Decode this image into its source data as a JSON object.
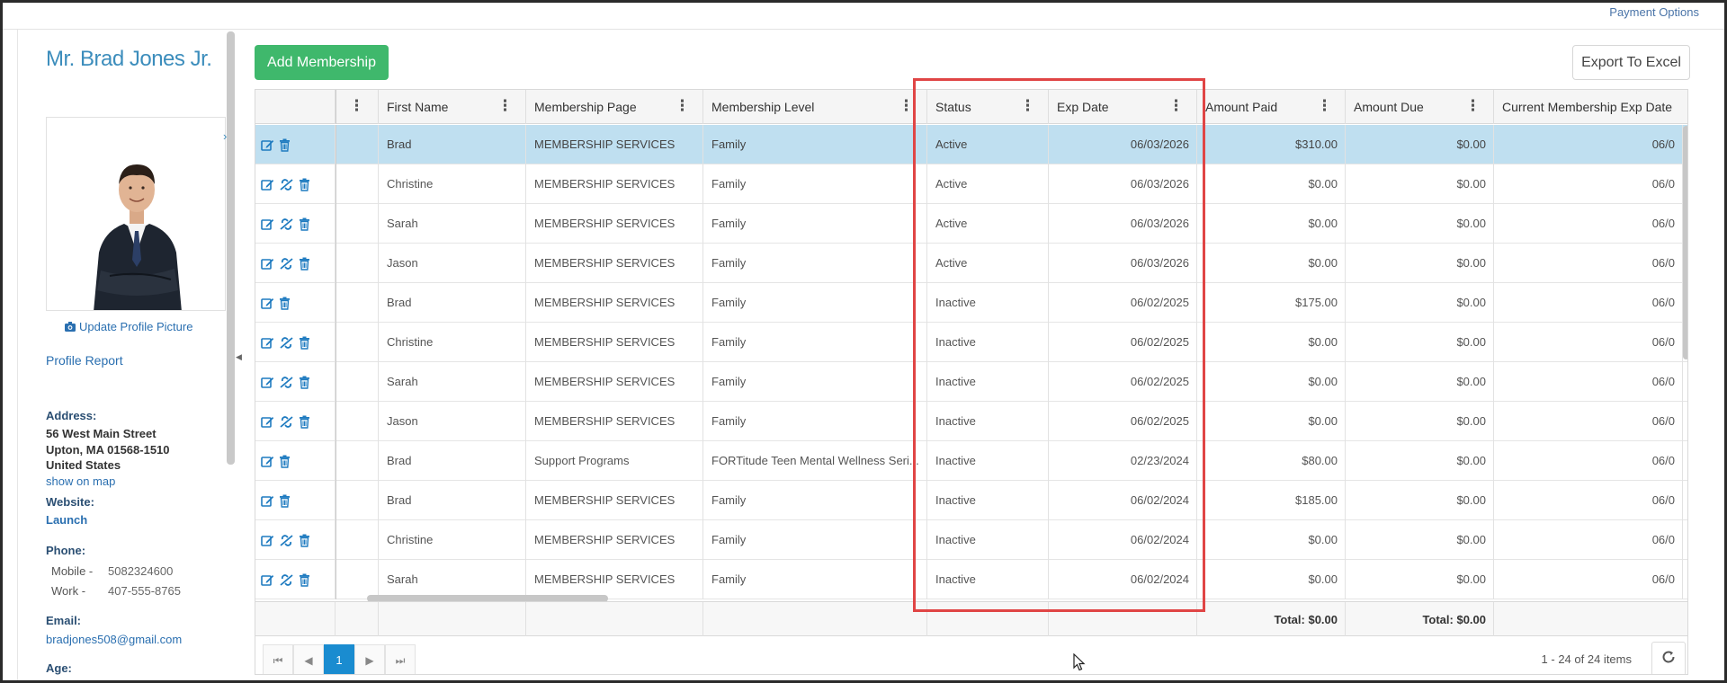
{
  "header": {
    "payment_options": "Payment Options"
  },
  "profile": {
    "name": "Mr. Brad Jones Jr.",
    "update_picture": "Update Profile Picture",
    "profile_report": "Profile Report",
    "address_label": "Address:",
    "address_line1": "56 West Main Street",
    "address_line2": "Upton, MA 01568-1510",
    "address_line3": "United States",
    "show_on_map": "show on map",
    "website_label": "Website:",
    "website_link": "Launch",
    "phone_label": "Phone:",
    "mobile_label": "Mobile -",
    "mobile_value": "5082324600",
    "work_label": "Work -",
    "work_value": "407-555-8765",
    "email_label": "Email:",
    "email_value": "bradjones508@gmail.com",
    "age_label": "Age:"
  },
  "toolbar": {
    "add_membership": "Add Membership",
    "export_to_excel": "Export To Excel"
  },
  "grid": {
    "columns": [
      "First Name",
      "Membership Page",
      "Membership Level",
      "Status",
      "Exp Date",
      "Amount Paid",
      "Amount Due",
      "Current Membership Exp Date"
    ],
    "rows": [
      {
        "first": "Brad",
        "page": "MEMBERSHIP SERVICES",
        "level": "Family",
        "status": "Active",
        "exp": "06/03/2026",
        "paid": "$310.00",
        "due": "$0.00",
        "current": "06/0",
        "link_icon": false
      },
      {
        "first": "Christine",
        "page": "MEMBERSHIP SERVICES",
        "level": "Family",
        "status": "Active",
        "exp": "06/03/2026",
        "paid": "$0.00",
        "due": "$0.00",
        "current": "06/0",
        "link_icon": true
      },
      {
        "first": "Sarah",
        "page": "MEMBERSHIP SERVICES",
        "level": "Family",
        "status": "Active",
        "exp": "06/03/2026",
        "paid": "$0.00",
        "due": "$0.00",
        "current": "06/0",
        "link_icon": true
      },
      {
        "first": "Jason",
        "page": "MEMBERSHIP SERVICES",
        "level": "Family",
        "status": "Active",
        "exp": "06/03/2026",
        "paid": "$0.00",
        "due": "$0.00",
        "current": "06/0",
        "link_icon": true
      },
      {
        "first": "Brad",
        "page": "MEMBERSHIP SERVICES",
        "level": "Family",
        "status": "Inactive",
        "exp": "06/02/2025",
        "paid": "$175.00",
        "due": "$0.00",
        "current": "06/0",
        "link_icon": false
      },
      {
        "first": "Christine",
        "page": "MEMBERSHIP SERVICES",
        "level": "Family",
        "status": "Inactive",
        "exp": "06/02/2025",
        "paid": "$0.00",
        "due": "$0.00",
        "current": "06/0",
        "link_icon": true
      },
      {
        "first": "Sarah",
        "page": "MEMBERSHIP SERVICES",
        "level": "Family",
        "status": "Inactive",
        "exp": "06/02/2025",
        "paid": "$0.00",
        "due": "$0.00",
        "current": "06/0",
        "link_icon": true
      },
      {
        "first": "Jason",
        "page": "MEMBERSHIP SERVICES",
        "level": "Family",
        "status": "Inactive",
        "exp": "06/02/2025",
        "paid": "$0.00",
        "due": "$0.00",
        "current": "06/0",
        "link_icon": true
      },
      {
        "first": "Brad",
        "page": "Support Programs",
        "level": "FORTitude Teen Mental Wellness Seri...",
        "status": "Inactive",
        "exp": "02/23/2024",
        "paid": "$80.00",
        "due": "$0.00",
        "current": "06/0",
        "link_icon": false
      },
      {
        "first": "Brad",
        "page": "MEMBERSHIP SERVICES",
        "level": "Family",
        "status": "Inactive",
        "exp": "06/02/2024",
        "paid": "$185.00",
        "due": "$0.00",
        "current": "06/0",
        "link_icon": false
      },
      {
        "first": "Christine",
        "page": "MEMBERSHIP SERVICES",
        "level": "Family",
        "status": "Inactive",
        "exp": "06/02/2024",
        "paid": "$0.00",
        "due": "$0.00",
        "current": "06/0",
        "link_icon": true
      },
      {
        "first": "Sarah",
        "page": "MEMBERSHIP SERVICES",
        "level": "Family",
        "status": "Inactive",
        "exp": "06/02/2024",
        "paid": "$0.00",
        "due": "$0.00",
        "current": "06/0",
        "link_icon": true
      }
    ],
    "total_paid": "Total: $0.00",
    "total_due": "Total: $0.00"
  },
  "pager": {
    "current_page": "1",
    "items_text": "1 - 24 of 24 items"
  },
  "colors": {
    "accent_blue": "#3c8dbc",
    "add_button": "#3fb86c",
    "selected_row": "#bfdff0",
    "highlight": "#e04545",
    "pager_active": "#1a8cd0"
  },
  "icons": [
    "edit-icon",
    "unlink-icon",
    "trash-icon",
    "camera-icon",
    "kebab-icon",
    "first-page-icon",
    "prev-page-icon",
    "next-page-icon",
    "last-page-icon",
    "refresh-icon"
  ]
}
